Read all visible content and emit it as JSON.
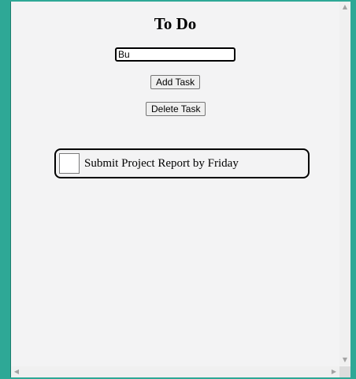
{
  "app": {
    "title": "To Do"
  },
  "form": {
    "input_value": "Bu",
    "add_label": "Add Task",
    "delete_label": "Delete Task"
  },
  "tasks": [
    {
      "text": "Submit Project Report by Friday",
      "checked": false
    }
  ],
  "icons": {
    "scroll_up": "▲",
    "scroll_down": "▼",
    "scroll_left": "◀",
    "scroll_right": "▶"
  },
  "colors": {
    "desktop": "#2ea896",
    "window": "#f3f3f4"
  }
}
